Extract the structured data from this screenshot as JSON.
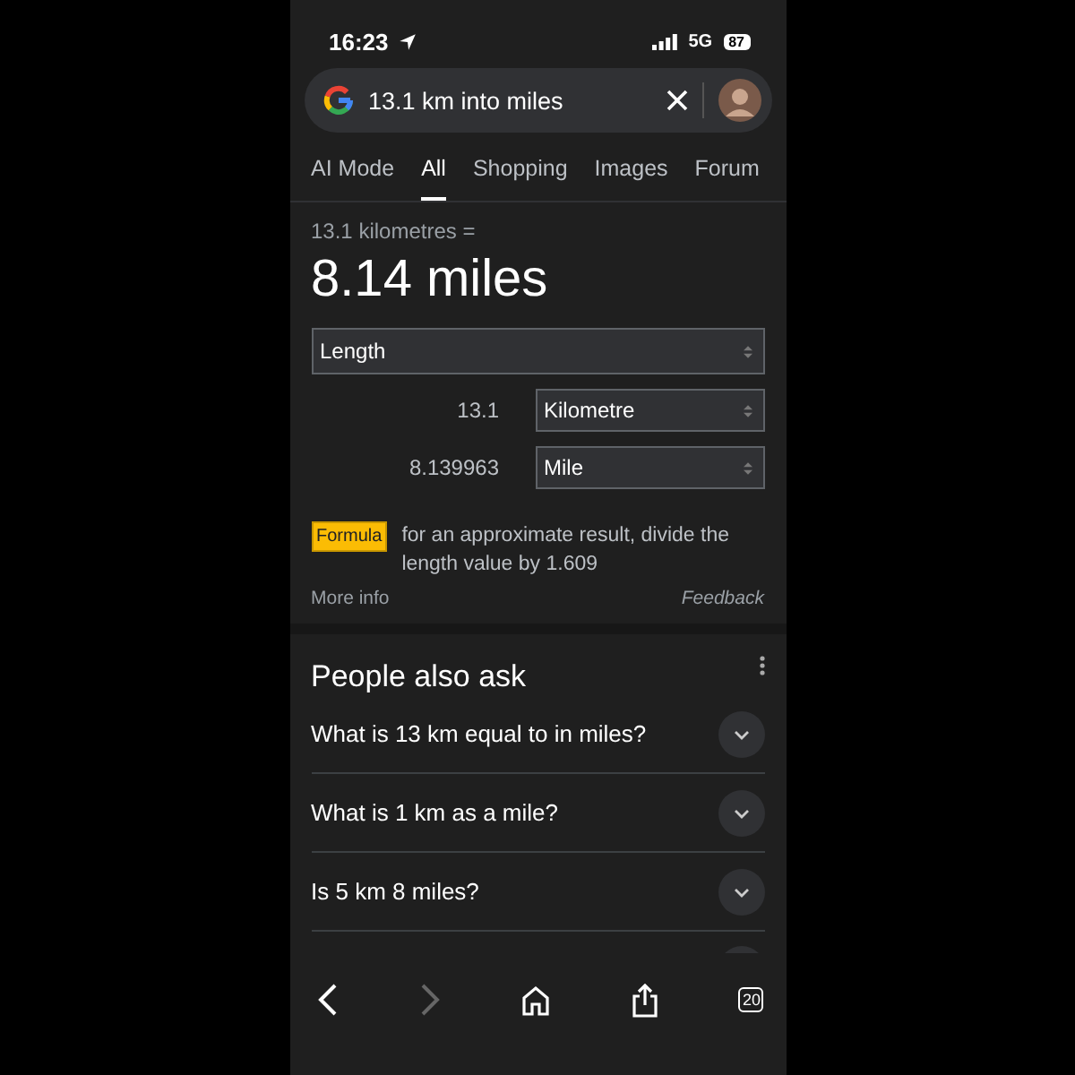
{
  "status_bar": {
    "time": "16:23",
    "network": "5G",
    "battery": "87"
  },
  "search": {
    "value": "13.1 km into miles"
  },
  "tabs": [
    {
      "label": "AI Mode",
      "selected": false
    },
    {
      "label": "All",
      "selected": true
    },
    {
      "label": "Shopping",
      "selected": false
    },
    {
      "label": "Images",
      "selected": false
    },
    {
      "label": "Forum",
      "selected": false
    }
  ],
  "converter": {
    "equation": "13.1 kilometres =",
    "result": "8.14 miles",
    "quantity": "Length",
    "rows": [
      {
        "value": "13.1",
        "unit": "Kilometre"
      },
      {
        "value": "8.139963",
        "unit": "Mile"
      }
    ],
    "formula_badge": "Formula",
    "formula_text": "for an approximate result, divide the length value by 1.609",
    "more_info": "More info",
    "feedback": "Feedback"
  },
  "people_also_ask": {
    "title": "People also ask",
    "questions": [
      "What is 13 km equal to in miles?",
      "What is 1 km as a mile?",
      "Is 5 km 8 miles?"
    ]
  },
  "toolbar": {
    "tab_count": "20"
  }
}
